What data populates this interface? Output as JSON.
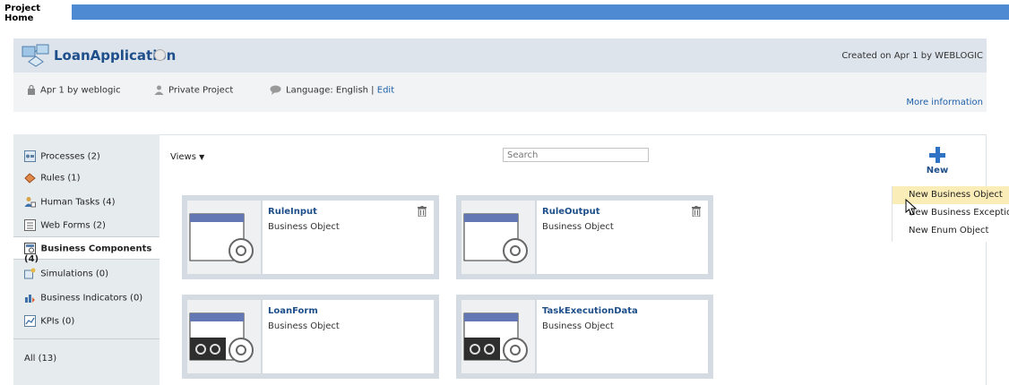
{
  "top_tab": "Project Home",
  "project": {
    "title": "LoanApplication",
    "created": "Created on Apr 1 by WEBLOGIC",
    "modified": "Apr 1 by weblogic",
    "privacy": "Private Project",
    "language_label": "Language: English |",
    "edit_label": "Edit",
    "more_info": "More information"
  },
  "sidebar": {
    "items": [
      {
        "label": "Processes (2)",
        "icon": "processes-icon"
      },
      {
        "label": "Rules (1)",
        "icon": "rules-icon"
      },
      {
        "label": "Human Tasks (4)",
        "icon": "human-tasks-icon"
      },
      {
        "label": "Web Forms (2)",
        "icon": "web-forms-icon"
      },
      {
        "label": "Business Components (4)",
        "icon": "business-components-icon",
        "active": true
      },
      {
        "label": "Simulations (0)",
        "icon": "simulations-icon"
      },
      {
        "label": "Business Indicators (0)",
        "icon": "business-indicators-icon"
      },
      {
        "label": "KPIs (0)",
        "icon": "kpis-icon"
      },
      {
        "label": "All (13)",
        "icon": ""
      }
    ]
  },
  "toolbar": {
    "views_label": "Views",
    "search_placeholder": "Search",
    "new_label": "New"
  },
  "new_menu": {
    "items": [
      "New Business Object",
      "New Business Exception",
      "New Enum Object"
    ],
    "highlighted_index": 0
  },
  "cards": [
    {
      "name": "RuleInput",
      "type": "Business Object"
    },
    {
      "name": "RuleOutput",
      "type": "Business Object"
    },
    {
      "name": "LoanForm",
      "type": "Business Object"
    },
    {
      "name": "TaskExecutionData",
      "type": "Business Object"
    }
  ],
  "colors": {
    "top_bar": "#4e8ad1",
    "link": "#1e5fa8",
    "title": "#1e4f8a",
    "menu_highlight": "#fbedb7"
  }
}
